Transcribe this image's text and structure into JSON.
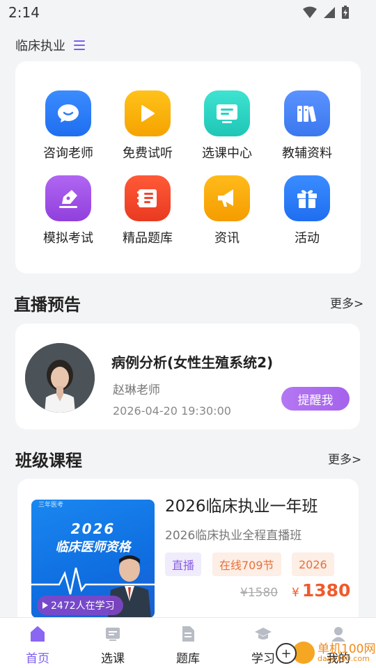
{
  "status_bar": {
    "time": "2:14"
  },
  "header": {
    "title": "临床执业"
  },
  "quick_menu": [
    {
      "label": "咨询老师",
      "icon": "chat-bubble-icon",
      "color": "#2f7df6"
    },
    {
      "label": "免费试听",
      "icon": "play-icon",
      "color": "#f7b200"
    },
    {
      "label": "选课中心",
      "icon": "course-screen-icon",
      "color": "#27d3c3"
    },
    {
      "label": "教辅资料",
      "icon": "books-icon",
      "color": "#4d86f5"
    },
    {
      "label": "模拟考试",
      "icon": "pen-icon",
      "color": "#a251e6"
    },
    {
      "label": "精品题库",
      "icon": "question-bank-icon",
      "color": "#f2452b"
    },
    {
      "label": "资讯",
      "icon": "megaphone-icon",
      "color": "#f7a800"
    },
    {
      "label": "活动",
      "icon": "gift-icon",
      "color": "#2b7cf2"
    }
  ],
  "live_section": {
    "title": "直播预告",
    "more": "更多>",
    "card": {
      "title": "病例分析(女性生殖系统2)",
      "teacher": "赵琳老师",
      "time": "2026-04-20 19:30:00",
      "button": "提醒我"
    }
  },
  "course_section": {
    "title": "班级课程",
    "more": "更多>",
    "card": {
      "thumb_small": "三年医考",
      "thumb_year": "2026",
      "thumb_line2": "临床医师资格",
      "learners": "2472人在学习",
      "title": "2026临床执业一年班",
      "subtitle": "2026临床执业全程直播班",
      "tags": [
        "直播",
        "在线709节",
        "2026"
      ],
      "old_price": "¥1580",
      "currency": "¥",
      "price": "1380"
    }
  },
  "bottom_nav": [
    {
      "label": "首页",
      "icon": "home-icon",
      "active": true
    },
    {
      "label": "选课",
      "icon": "course-select-icon",
      "active": false
    },
    {
      "label": "题库",
      "icon": "document-icon",
      "active": false
    },
    {
      "label": "学习",
      "icon": "graduation-cap-icon",
      "active": false
    },
    {
      "label": "我的",
      "icon": "profile-icon",
      "active": false
    }
  ],
  "watermark": {
    "line1": "单机100网",
    "line2": "danji100.com"
  },
  "colors": {
    "accent": "#7d5cf0",
    "price": "#f05a2b"
  }
}
